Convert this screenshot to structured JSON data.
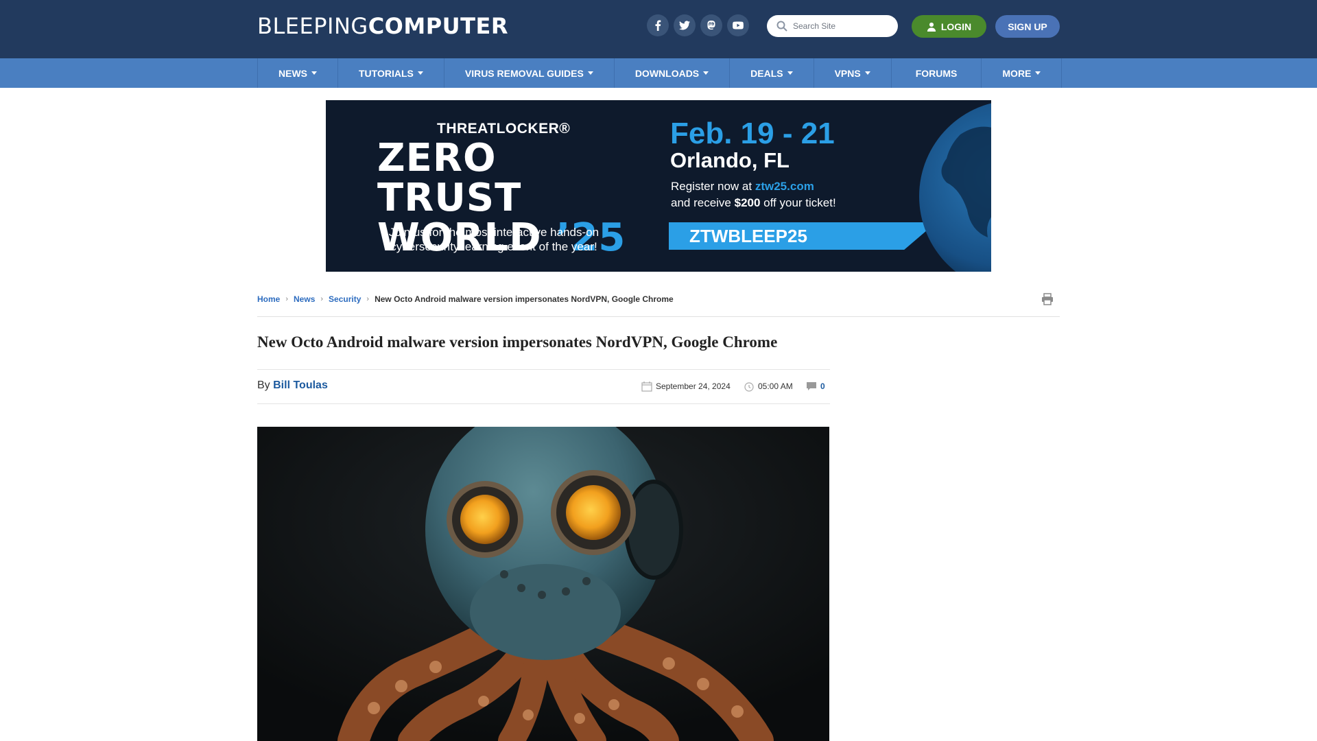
{
  "site": {
    "logo_light": "BLEEPING",
    "logo_bold": "COMPUTER"
  },
  "header": {
    "social": [
      "facebook-icon",
      "twitter-icon",
      "mastodon-icon",
      "youtube-icon"
    ],
    "search_placeholder": "Search Site",
    "login_label": "LOGIN",
    "signup_label": "SIGN UP"
  },
  "nav": {
    "items": [
      {
        "label": "NEWS",
        "dropdown": true
      },
      {
        "label": "TUTORIALS",
        "dropdown": true
      },
      {
        "label": "VIRUS REMOVAL GUIDES",
        "dropdown": true
      },
      {
        "label": "DOWNLOADS",
        "dropdown": true
      },
      {
        "label": "DEALS",
        "dropdown": true
      },
      {
        "label": "VPNS",
        "dropdown": true
      },
      {
        "label": "FORUMS",
        "dropdown": false
      },
      {
        "label": "MORE",
        "dropdown": true
      }
    ]
  },
  "ad": {
    "brand": "THREATLOCKER®",
    "headline_line1": "ZERO TRUST",
    "headline_line2": "WORLD",
    "headline_year": "’25",
    "tagline": "Join us for the most interactive hands-on cybersecurity learning event of the year!",
    "dates": "Feb. 19 - 21",
    "city": "Orlando, FL",
    "register_prefix": "Register now at ",
    "register_link": "ztw25.com",
    "discount_prefix": "and receive ",
    "discount_amount": "$200",
    "discount_suffix": " off your ticket!",
    "promo_code": "ZTWBLEEP25"
  },
  "breadcrumb": {
    "home": "Home",
    "news": "News",
    "security": "Security",
    "current": "New Octo Android malware version impersonates NordVPN, Google Chrome"
  },
  "article": {
    "title": "New Octo Android malware version impersonates NordVPN, Google Chrome",
    "by_label": "By",
    "author": "Bill Toulas",
    "date": "September 24, 2024",
    "time": "05:00 AM",
    "comments": "0"
  },
  "colors": {
    "header_bg": "#223a5e",
    "nav_bg": "#4a7fc1",
    "login_bg": "#4a8a2c",
    "signup_bg": "#4a72b6",
    "link": "#2d6cbf",
    "ad_accent": "#2b9fe6"
  }
}
